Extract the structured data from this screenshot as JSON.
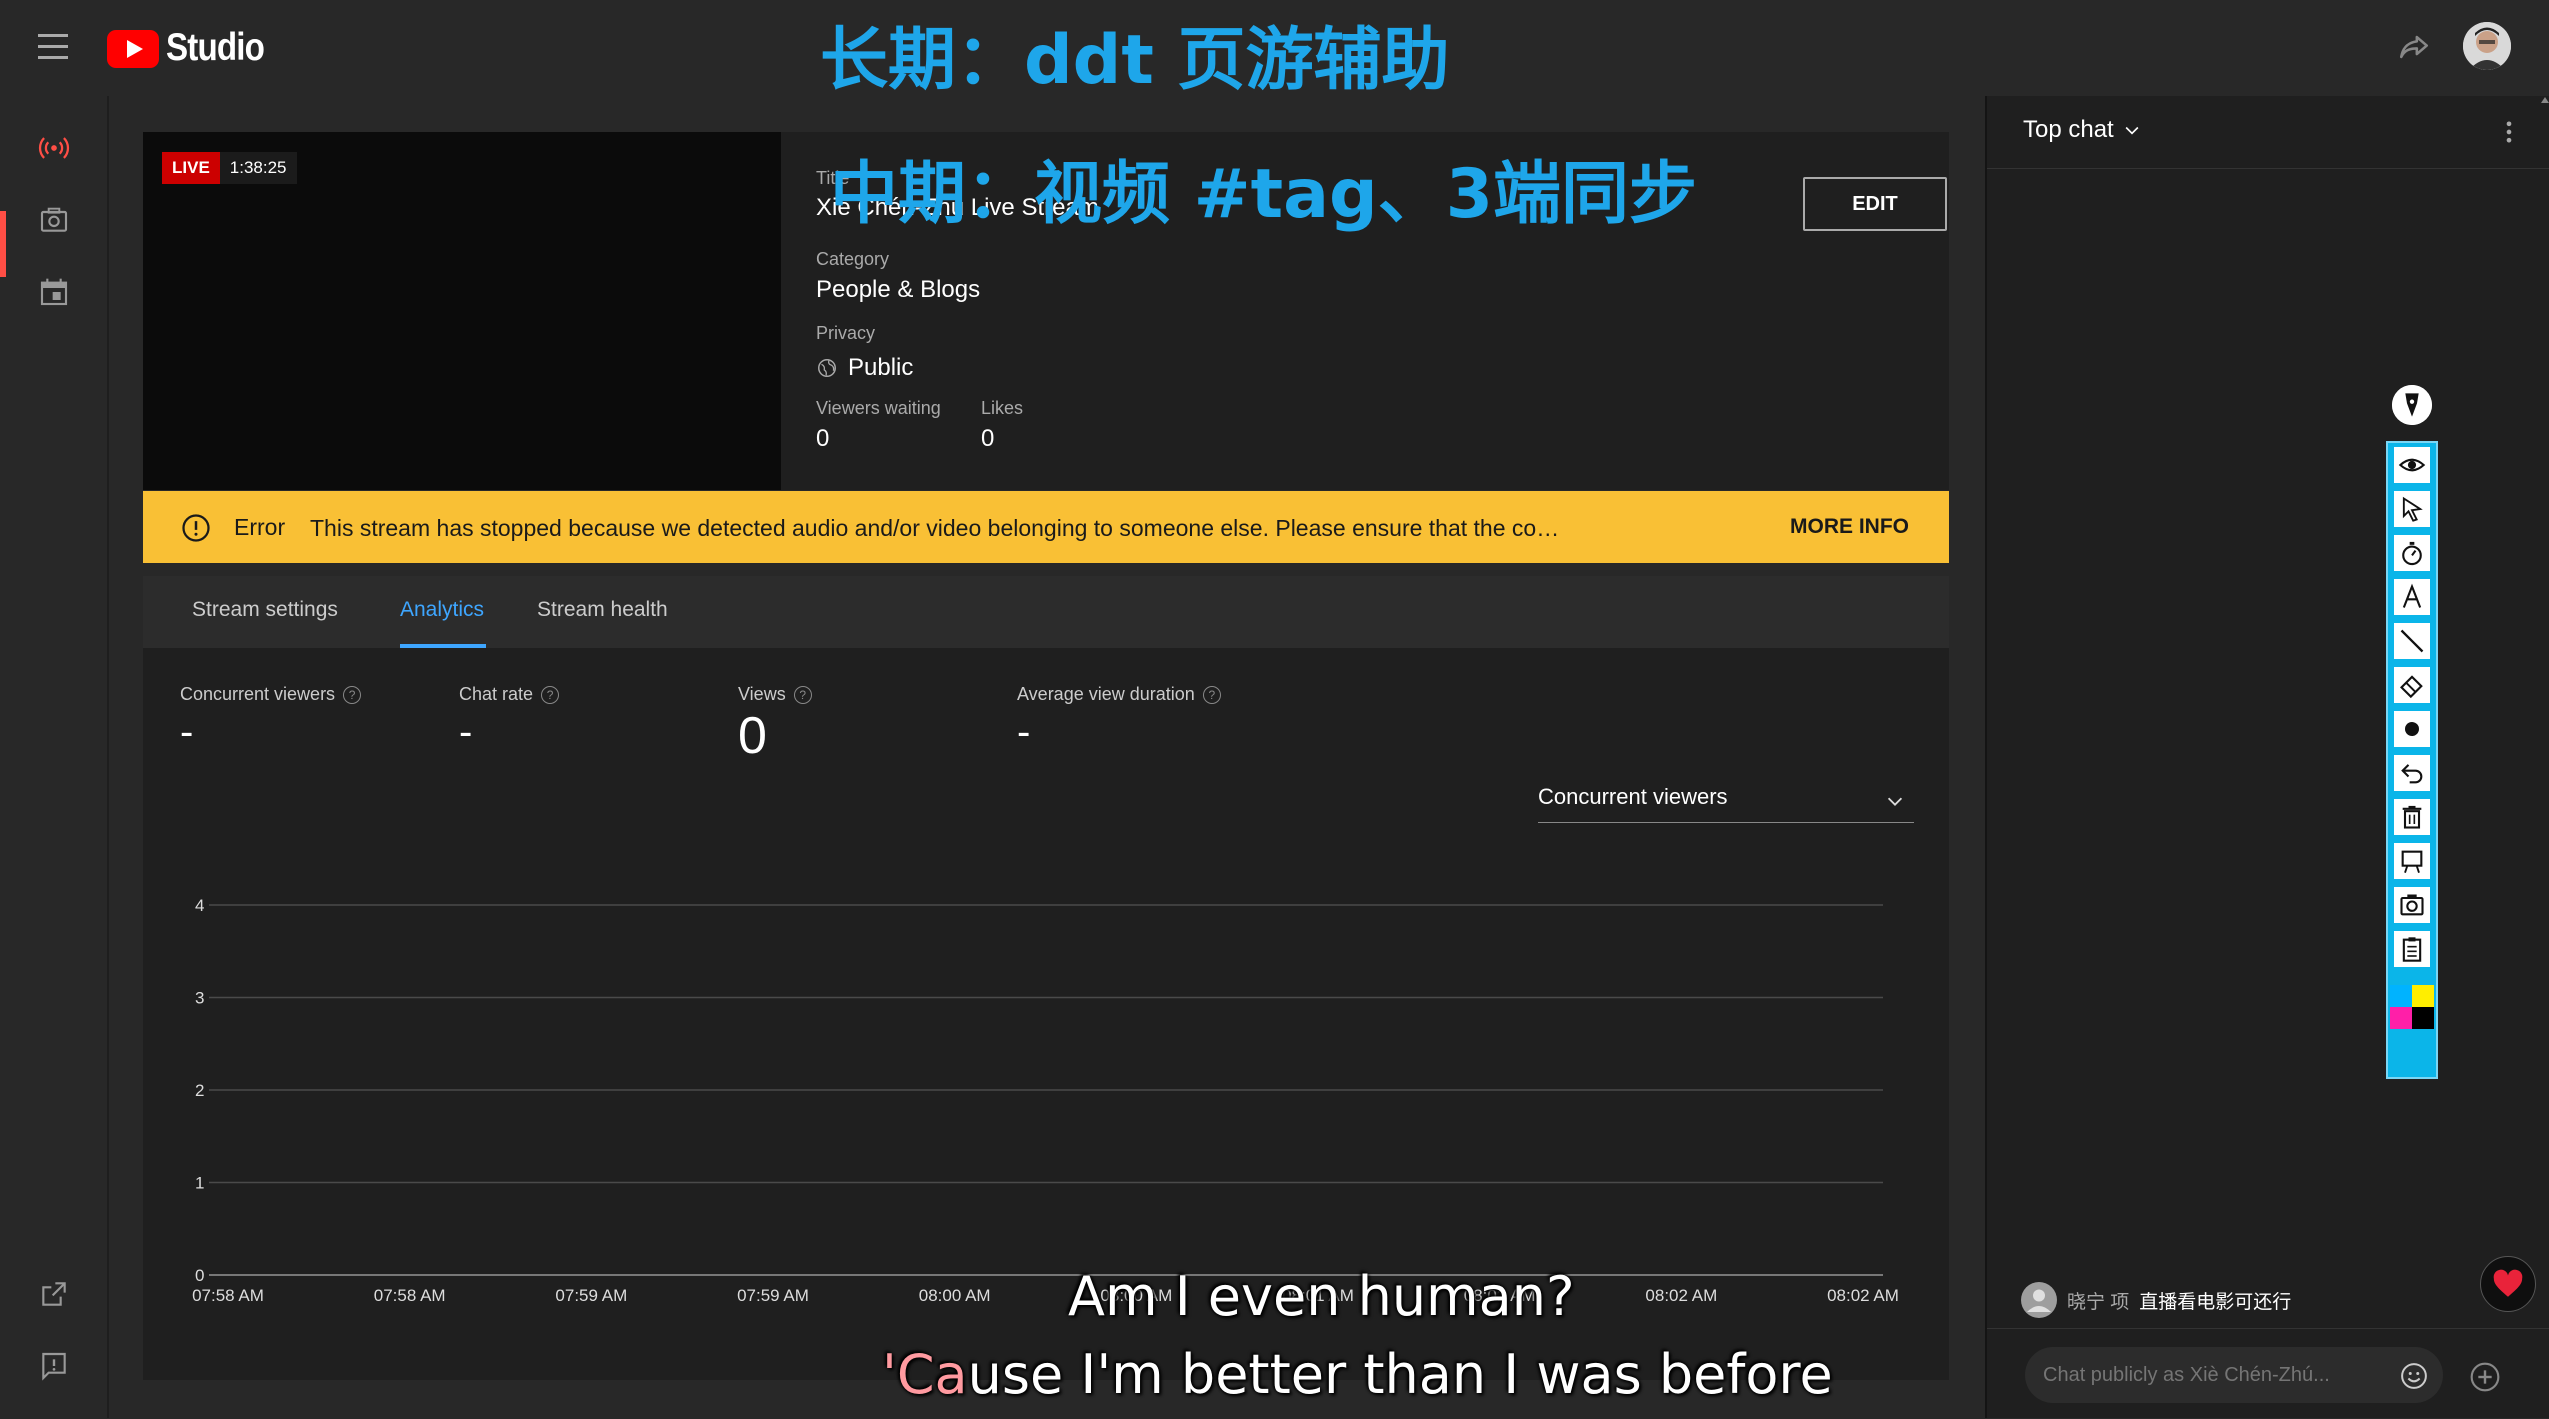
{
  "app": {
    "brand": "Studio"
  },
  "overlays": {
    "line1": "长期：ddt 页游辅助",
    "line2": "中期：视频 #tag、3端同步"
  },
  "left_rail": {
    "items": [
      {
        "name": "live-icon",
        "active": true
      },
      {
        "name": "camera-icon",
        "active": false
      },
      {
        "name": "calendar-icon",
        "active": false
      }
    ],
    "bottom": [
      {
        "name": "external-link-icon"
      },
      {
        "name": "feedback-icon"
      }
    ]
  },
  "stream": {
    "live_label": "LIVE",
    "elapsed": "1:38:25",
    "title_label": "Title",
    "title": "Xiè Chén-Zhú Live Stream",
    "category_label": "Category",
    "category": "People & Blogs",
    "privacy_label": "Privacy",
    "privacy": "Public",
    "viewers_waiting_label": "Viewers waiting",
    "viewers_waiting": "0",
    "likes_label": "Likes",
    "likes": "0",
    "edit_label": "EDIT"
  },
  "error": {
    "title": "Error",
    "message": "This stream has stopped because we detected audio and/or video belonging to someone else. Please ensure that the co…",
    "more_info": "MORE INFO",
    "color": "#f9c035"
  },
  "tabs": [
    {
      "label": "Stream settings",
      "active": false
    },
    {
      "label": "Analytics",
      "active": true
    },
    {
      "label": "Stream health",
      "active": false
    }
  ],
  "metrics": [
    {
      "label": "Concurrent viewers",
      "value": "-"
    },
    {
      "label": "Chat rate",
      "value": "-"
    },
    {
      "label": "Views",
      "value": "0"
    },
    {
      "label": "Average view duration",
      "value": "-"
    }
  ],
  "chart_select": {
    "selected": "Concurrent viewers"
  },
  "chart_data": {
    "type": "line",
    "title": "",
    "xlabel": "",
    "ylabel": "",
    "x": [
      "07:58 AM",
      "07:58 AM",
      "07:59 AM",
      "07:59 AM",
      "08:00 AM",
      "08:00 AM",
      "08:01 AM",
      "08:01 AM",
      "08:02 AM",
      "08:02 AM"
    ],
    "yticks": [
      "0",
      "1",
      "2",
      "3",
      "4"
    ],
    "ylim": [
      0,
      4
    ],
    "series": [],
    "grid": true
  },
  "subtitles": {
    "line1": "Am I even human?",
    "line2_accent": "'Ca",
    "line2_rest": "use I'm better than I was before"
  },
  "chat": {
    "title": "Top chat",
    "message_author": "晓宁 项",
    "message_text": "直播看电影可还行",
    "input_placeholder": "Chat publicly as Xiè Chén-Zhú..."
  },
  "toolbar": {
    "tools": [
      "eye-icon",
      "cursor-icon",
      "timer-icon",
      "text-icon",
      "line-icon",
      "eraser-icon",
      "dot-icon",
      "undo-icon",
      "trash-icon",
      "whiteboard-icon",
      "screenshot-icon",
      "clipboard-icon",
      "color-palette-icon"
    ],
    "accent": "#0bb5e9"
  }
}
